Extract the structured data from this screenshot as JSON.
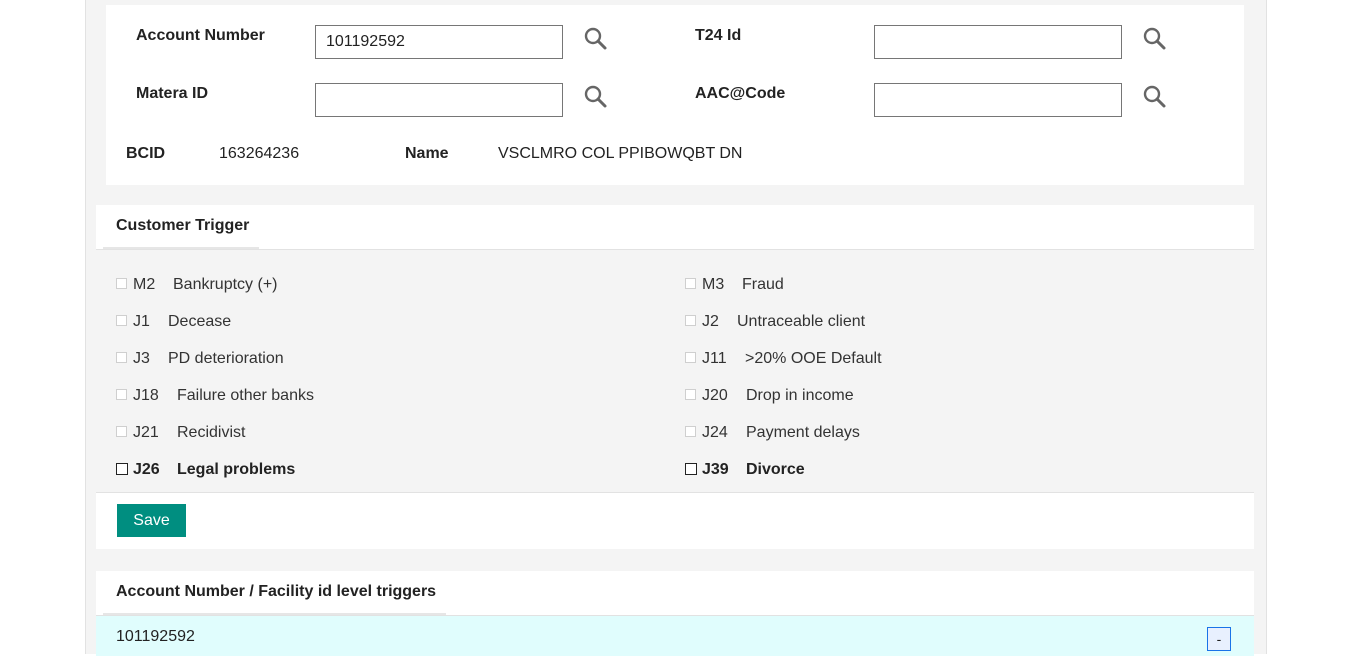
{
  "search": {
    "account_number_label": "Account Number",
    "account_number_value": "101192592",
    "t24_label": "T24 Id",
    "t24_value": "",
    "matera_label": "Matera ID",
    "matera_value": "",
    "aac_label": "AAC@Code",
    "aac_value": ""
  },
  "customer_info": {
    "bcid_label": "BCID",
    "bcid_value": "163264236",
    "name_label": "Name",
    "name_value": "VSCLMRO COL PPIBOWQBT DN"
  },
  "customer_trigger": {
    "title": "Customer Trigger",
    "items": [
      {
        "code": "M2",
        "label": "Bankruptcy (+)",
        "checked": false,
        "enabled": false
      },
      {
        "code": "M3",
        "label": "Fraud",
        "checked": false,
        "enabled": false
      },
      {
        "code": "J1",
        "label": "Decease",
        "checked": false,
        "enabled": false
      },
      {
        "code": "J2",
        "label": "Untraceable client",
        "checked": false,
        "enabled": false
      },
      {
        "code": "J3",
        "label": "PD deterioration",
        "checked": false,
        "enabled": false
      },
      {
        "code": "J11",
        "label": ">20% OOE Default",
        "checked": false,
        "enabled": false
      },
      {
        "code": "J18",
        "label": "Failure other banks",
        "checked": false,
        "enabled": false
      },
      {
        "code": "J20",
        "label": "Drop in income",
        "checked": false,
        "enabled": false
      },
      {
        "code": "J21",
        "label": "Recidivist",
        "checked": false,
        "enabled": false
      },
      {
        "code": "J24",
        "label": "Payment delays",
        "checked": false,
        "enabled": false
      },
      {
        "code": "J26",
        "label": "Legal problems",
        "checked": false,
        "enabled": true
      },
      {
        "code": "J39",
        "label": "Divorce",
        "checked": false,
        "enabled": true
      }
    ],
    "save_label": "Save"
  },
  "account_triggers": {
    "title": "Account Number / Facility id level triggers",
    "account_number": "101192592",
    "collapse_label": "-"
  },
  "colors": {
    "save_button": "#008e80",
    "account_row_bg": "#e0fdfd",
    "panel_bg": "#f4f4f4"
  },
  "icons": {
    "search": "search-icon"
  }
}
